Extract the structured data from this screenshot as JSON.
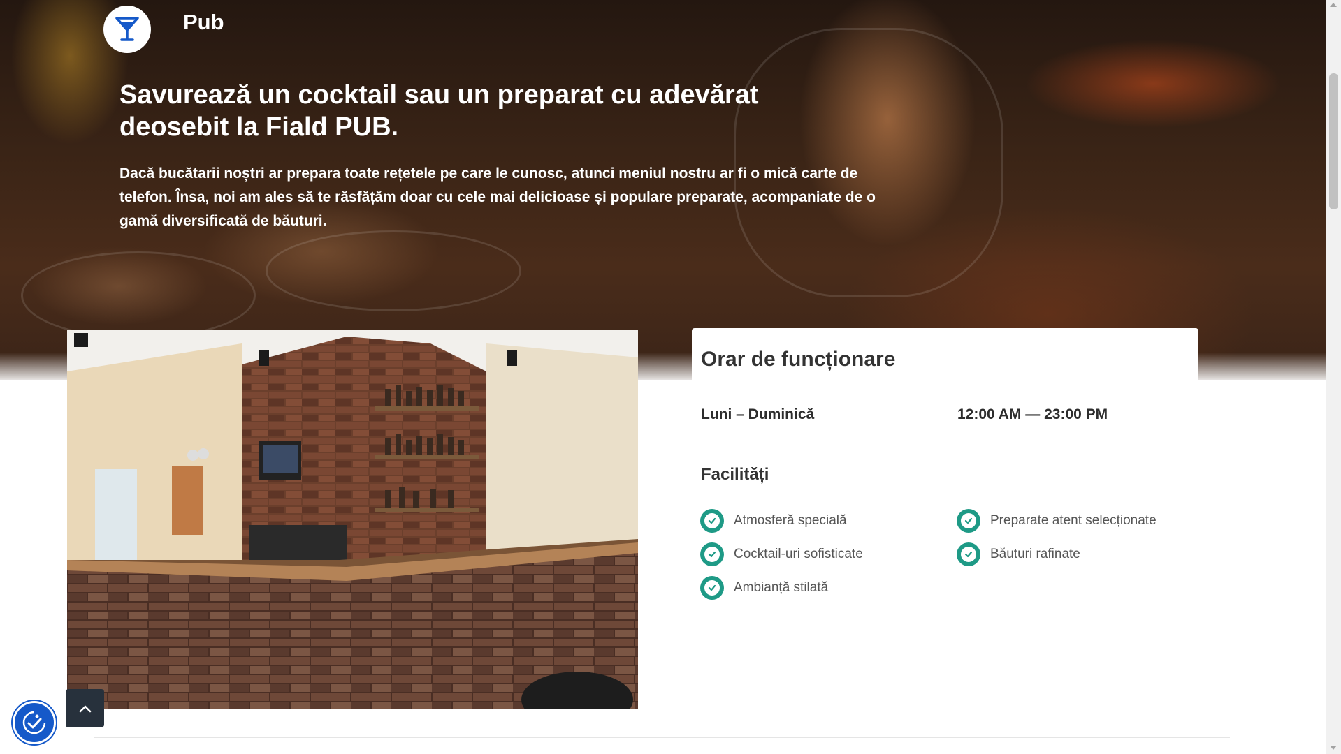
{
  "brand": {
    "name": "Pub",
    "icon": "cocktail-glass-icon",
    "accent": "#1559c9"
  },
  "hero": {
    "title": "Savurează un cocktail sau un preparat cu adevărat deosebit la Fiald PUB.",
    "text": "Dacă bucătarii noștri ar prepara toate rețetele pe care le cunosc, atunci meniul nostru ar fi o mică carte de telefon. Însa, noi am ales să te răsfățăm doar cu cele mai delicioase și populare preparate, acompaniate de o gamă diversificată de băuturi."
  },
  "hours": {
    "title": "Orar de funcționare",
    "days": "Luni – Duminică",
    "time": "12:00 AM — 23:00 PM"
  },
  "facilities": {
    "title": "Facilități",
    "check_color": "#1e9a86",
    "items": [
      "Atmosferă specială",
      "Preparate atent selecționate",
      "Cocktail-uri sofisticate",
      "Băuturi rafinate",
      "Ambianță stilată"
    ]
  },
  "controls": {
    "accessibility_icon": "accessibility-icon",
    "scroll_top_icon": "chevron-up-icon"
  }
}
